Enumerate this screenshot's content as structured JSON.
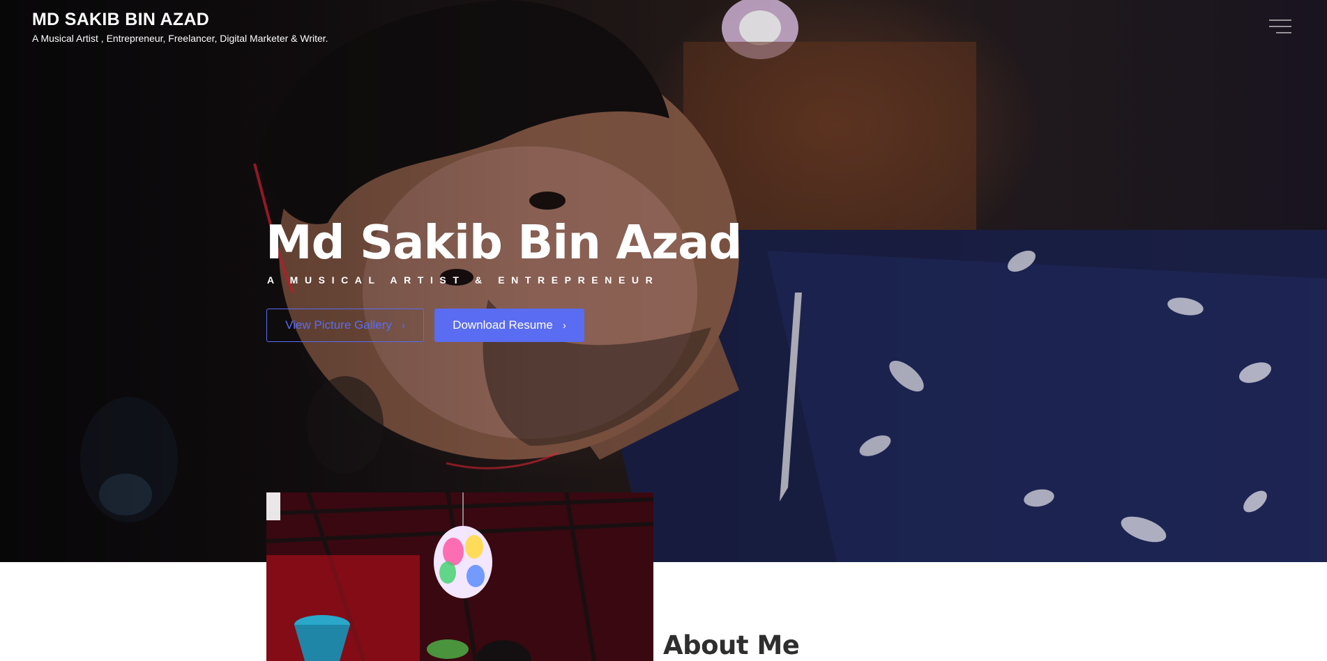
{
  "header": {
    "site_title": "MD SAKIB BIN AZAD",
    "tagline": "A Musical Artist , Entrepreneur, Freelancer, Digital Marketer & Writer.",
    "menu_icon": "hamburger-menu-icon"
  },
  "hero": {
    "heading": "Md Sakib Bin Azad",
    "subtitle": "A MUSICAL ARTIST & ENTREPRENEUR",
    "buttons": {
      "gallery_label": "View Picture Gallery",
      "resume_label": "Download Resume",
      "chevron": "›",
      "chevron_icon": "chevron-right-icon"
    },
    "accent_color": "#5a6cf2"
  },
  "about": {
    "heading": "About Me"
  }
}
